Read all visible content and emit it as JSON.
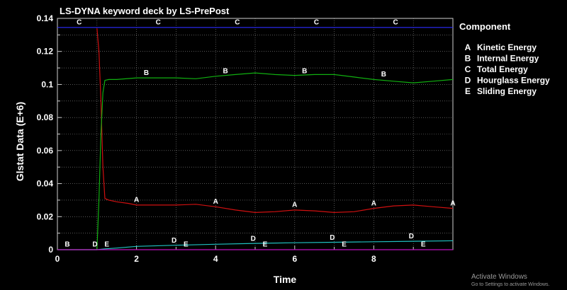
{
  "chart_data": {
    "type": "line",
    "title": "LS-DYNA keyword deck by LS-PrePost",
    "xlabel": "Time",
    "ylabel": "Glstat Data (E+6)",
    "xlim": [
      0,
      10
    ],
    "ylim": [
      0,
      0.14
    ],
    "x_ticks": [
      "0",
      "2",
      "4",
      "6",
      "8"
    ],
    "y_ticks": [
      "0",
      "0.02",
      "0.04",
      "0.06",
      "0.08",
      "0.1",
      "0.12",
      "0.14"
    ],
    "grid": true,
    "legend_title": "Component",
    "legend_position": "right",
    "series": [
      {
        "letter": "A",
        "name": "Kinetic Energy",
        "color": "#d01010",
        "x": [
          1.0,
          1.05,
          1.1,
          1.15,
          1.2,
          1.3,
          1.5,
          1.8,
          2.0,
          2.5,
          3.0,
          3.5,
          4.0,
          4.5,
          5.0,
          5.5,
          6.0,
          6.5,
          7.0,
          7.5,
          8.0,
          8.5,
          9.0,
          9.5,
          10.0
        ],
        "y": [
          0.134,
          0.12,
          0.09,
          0.05,
          0.031,
          0.03,
          0.029,
          0.028,
          0.027,
          0.027,
          0.027,
          0.0275,
          0.026,
          0.024,
          0.0225,
          0.023,
          0.024,
          0.0235,
          0.0225,
          0.023,
          0.025,
          0.0265,
          0.027,
          0.026,
          0.025
        ],
        "markers": [
          {
            "x": 2.0,
            "y": 0.028
          },
          {
            "x": 4.0,
            "y": 0.027
          },
          {
            "x": 6.0,
            "y": 0.025
          },
          {
            "x": 8.0,
            "y": 0.026
          },
          {
            "x": 10.0,
            "y": 0.026
          }
        ]
      },
      {
        "letter": "B",
        "name": "Internal Energy",
        "color": "#10b010",
        "x": [
          0,
          1.0,
          1.05,
          1.1,
          1.15,
          1.2,
          1.3,
          1.5,
          2.0,
          2.5,
          3.0,
          3.5,
          4.0,
          4.5,
          5.0,
          5.5,
          6.0,
          6.5,
          7.0,
          7.5,
          8.0,
          8.5,
          9.0,
          9.5,
          10.0
        ],
        "y": [
          0,
          0,
          0.03,
          0.07,
          0.095,
          0.1025,
          0.103,
          0.103,
          0.104,
          0.104,
          0.104,
          0.1035,
          0.105,
          0.106,
          0.107,
          0.106,
          0.1055,
          0.106,
          0.106,
          0.1045,
          0.103,
          0.102,
          0.101,
          0.102,
          0.103
        ],
        "markers": [
          {
            "x": 0.25,
            "y": 0.001
          },
          {
            "x": 2.25,
            "y": 0.105
          },
          {
            "x": 4.25,
            "y": 0.106
          },
          {
            "x": 6.25,
            "y": 0.106
          },
          {
            "x": 8.25,
            "y": 0.104
          }
        ]
      },
      {
        "letter": "C",
        "name": "Total Energy",
        "color": "#2a2aff",
        "x": [
          0,
          10
        ],
        "y": [
          0.1345,
          0.1345
        ],
        "markers": [
          {
            "x": 0.55,
            "y": 0.1355
          },
          {
            "x": 2.55,
            "y": 0.1355
          },
          {
            "x": 4.55,
            "y": 0.1355
          },
          {
            "x": 6.55,
            "y": 0.1355
          },
          {
            "x": 8.55,
            "y": 0.1355
          }
        ]
      },
      {
        "letter": "D",
        "name": "Hourglass Energy",
        "color": "#20c0c0",
        "x": [
          0,
          1.0,
          1.2,
          1.5,
          2.0,
          3.0,
          4.0,
          5.0,
          6.0,
          7.0,
          8.0,
          9.0,
          10.0
        ],
        "y": [
          0,
          0,
          0.0005,
          0.001,
          0.002,
          0.0027,
          0.0033,
          0.0038,
          0.0042,
          0.0045,
          0.0048,
          0.0051,
          0.0054
        ],
        "markers": [
          {
            "x": 0.95,
            "y": 0.001
          },
          {
            "x": 2.95,
            "y": 0.0035
          },
          {
            "x": 4.95,
            "y": 0.0045
          },
          {
            "x": 6.95,
            "y": 0.0052
          },
          {
            "x": 8.95,
            "y": 0.006
          }
        ]
      },
      {
        "letter": "E",
        "name": "Sliding Energy",
        "color": "#c010c0",
        "x": [
          0,
          10
        ],
        "y": [
          0,
          0
        ],
        "markers": [
          {
            "x": 1.25,
            "y": 0.001
          },
          {
            "x": 3.25,
            "y": 0.001
          },
          {
            "x": 5.25,
            "y": 0.001
          },
          {
            "x": 7.25,
            "y": 0.001
          },
          {
            "x": 9.25,
            "y": 0.001
          }
        ]
      }
    ]
  },
  "watermark": {
    "line1": "Activate Windows",
    "line2": "Go to Settings to activate Windows."
  }
}
